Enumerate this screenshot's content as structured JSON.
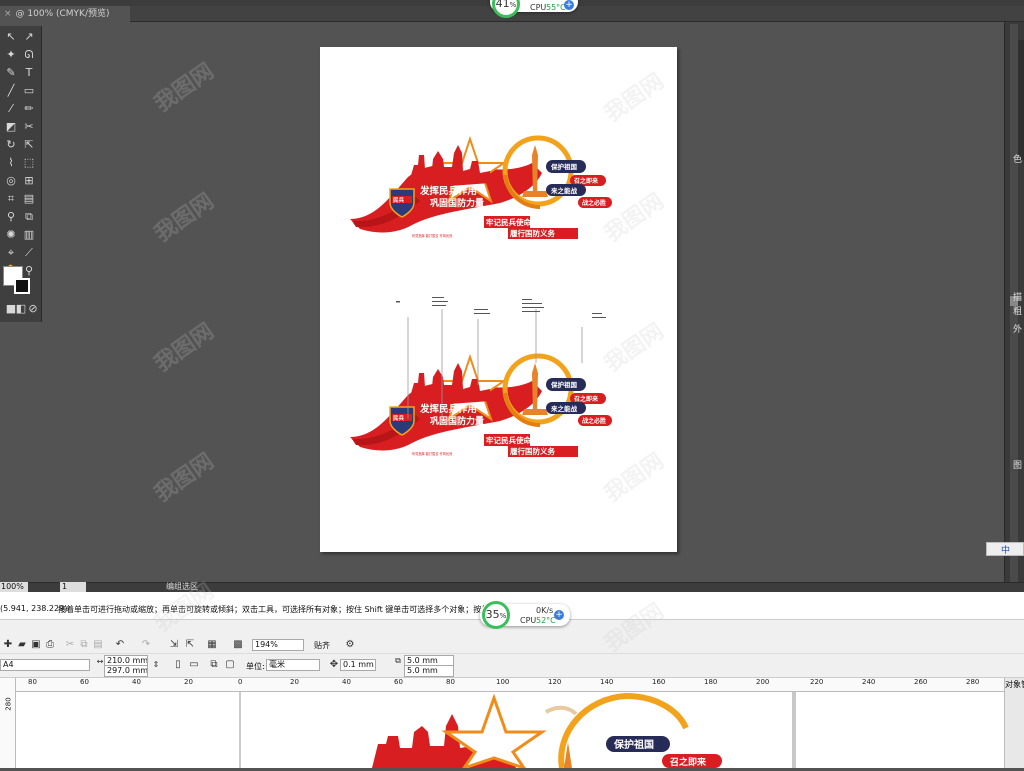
{
  "illustrator": {
    "tab_label": "@ 100% (CMYK/预览)",
    "tab_close": "×",
    "zoom": "100%",
    "page": "1",
    "status": "编组选区",
    "right_labels": [
      "色",
      "描",
      "粗",
      "外",
      "图"
    ]
  },
  "cpu_widget_top": {
    "percent": "41",
    "unit": "%",
    "label": "CPU",
    "temp": "55°C"
  },
  "cpu_widget_bottom": {
    "percent": "35",
    "unit": "%",
    "net": "0K/s",
    "label": "CPU",
    "temp": "52°C"
  },
  "design": {
    "badge": "民兵",
    "headline_1": "发挥民兵作用",
    "headline_2": "巩固国防力量",
    "pill_1": "保护祖国",
    "pill_2": "召之即来",
    "pill_3": "来之能战",
    "pill_4": "战之必胜",
    "sub_1": "牢记民兵使命",
    "sub_2": "履行国防义务",
    "tiny": "听党指挥 能打胜仗 作风优良"
  },
  "ime": {
    "label": "中"
  },
  "coreldraw": {
    "coordinates": "(5.941, 238.229)",
    "hint": "接着单击可进行拖动或缩放；再单击可旋转或倾斜；双击工具，可选择所有对象；按住 Shift 键单击可选择多个对象；按住 Alt 键单击...",
    "zoom": "194%",
    "snap": "贴齐",
    "paper": "A4",
    "width": "210.0 mm",
    "height": "297.0 mm",
    "unit_label": "单位:",
    "unit": "毫米",
    "nudge": "0.1 mm",
    "dup_x": "5.0 mm",
    "dup_y": "5.0 mm",
    "ruler_ticks": [
      "80",
      "60",
      "40",
      "20",
      "0",
      "20",
      "40",
      "60",
      "80",
      "100",
      "120",
      "140",
      "160",
      "180",
      "200",
      "220",
      "240",
      "260",
      "280"
    ],
    "vruler": "280",
    "panel": "对象管"
  },
  "watermark": "我图网"
}
